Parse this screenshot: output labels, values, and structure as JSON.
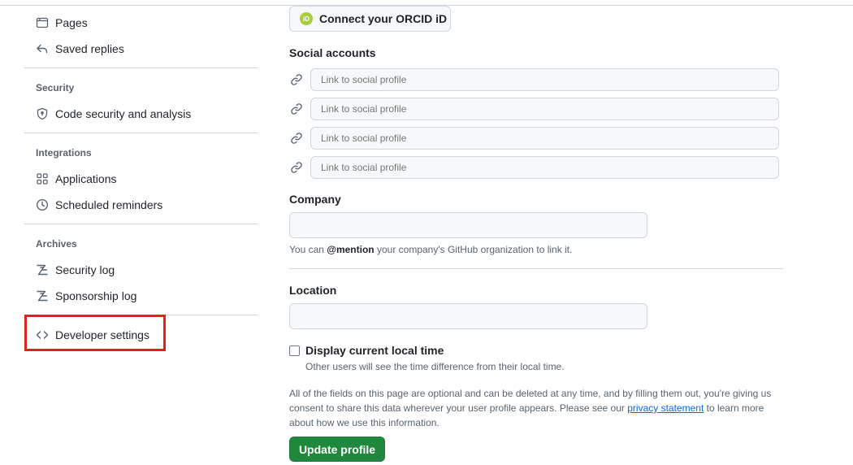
{
  "sidebar": {
    "items_top": [
      {
        "label": "Pages",
        "icon": "browser-icon"
      },
      {
        "label": "Saved replies",
        "icon": "reply-icon"
      }
    ],
    "security": {
      "heading": "Security",
      "items": [
        {
          "label": "Code security and analysis",
          "icon": "shield-icon"
        }
      ]
    },
    "integrations": {
      "heading": "Integrations",
      "items": [
        {
          "label": "Applications",
          "icon": "apps-icon"
        },
        {
          "label": "Scheduled reminders",
          "icon": "clock-icon"
        }
      ]
    },
    "archives": {
      "heading": "Archives",
      "items": [
        {
          "label": "Security log",
          "icon": "log-icon"
        },
        {
          "label": "Sponsorship log",
          "icon": "log-icon"
        }
      ]
    },
    "developer": {
      "label": "Developer settings",
      "icon": "code-icon"
    },
    "highlight_color": "#e81f16"
  },
  "main": {
    "orcid_button": "Connect your ORCID iD",
    "orcid_badge": "iD",
    "social": {
      "label": "Social accounts",
      "placeholders": [
        "Link to social profile",
        "Link to social profile",
        "Link to social profile",
        "Link to social profile"
      ]
    },
    "company": {
      "label": "Company",
      "value": "",
      "note_prefix": "You can ",
      "note_mention": "@mention",
      "note_suffix": " your company's GitHub organization to link it."
    },
    "location": {
      "label": "Location",
      "value": ""
    },
    "local_time": {
      "label": "Display current local time",
      "checked": false,
      "note": "Other users will see the time difference from their local time."
    },
    "privacy": {
      "text_before": "All of the fields on this page are optional and can be deleted at any time, and by filling them out, you're giving us consent to share this data wherever your user profile appears. Please see our ",
      "link": "privacy statement",
      "text_after": " to learn more about how we use this information."
    },
    "update_button": "Update profile",
    "accent_color": "#1f883d"
  }
}
